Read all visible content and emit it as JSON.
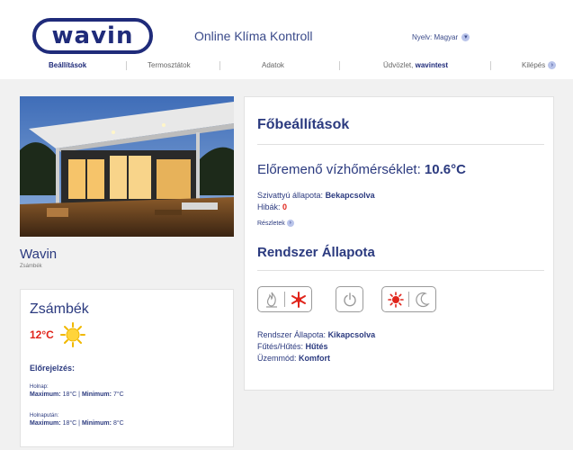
{
  "header": {
    "logo_text": "wavin",
    "app_title": "Online Klíma Kontroll",
    "language_label": "Nyelv:",
    "language_value": "Magyar"
  },
  "nav": {
    "items": [
      "Beállítások",
      "Termosztátok",
      "Adatok"
    ],
    "welcome_label": "Üdvözlet,",
    "welcome_user": "wavintest",
    "logout": "Kilépés"
  },
  "location": {
    "name": "Wavin",
    "sub": "Zsámbék"
  },
  "weather": {
    "city": "Zsámbék",
    "temp": "12°C",
    "forecast_title": "Előrejelzés:",
    "days": [
      {
        "label": "Holnap:",
        "max_label": "Maximum:",
        "max": "18°C",
        "min_label": "Minimum:",
        "min": "7°C"
      },
      {
        "label": "Holnapután:",
        "max_label": "Maximum:",
        "max": "18°C",
        "min_label": "Minimum:",
        "min": "8°C"
      }
    ]
  },
  "main": {
    "title": "Főbeállítások",
    "flow_label": "Előremenő vízhőmérséklet:",
    "flow_value": "10.6°C",
    "pump_label": "Szivattyú állapota:",
    "pump_value": "Bekapcsolva",
    "errors_label": "Hibák:",
    "errors_value": "0",
    "details_link": "Részletek",
    "system_title": "Rendszer Állapota",
    "system_state_label": "Rendszer Állapota:",
    "system_state_value": "Kikapcsolva",
    "heat_cool_label": "Fűtés/Hűtés:",
    "heat_cool_value": "Hűtés",
    "mode_label": "Üzemmód:",
    "mode_value": "Komfort"
  },
  "colors": {
    "brand": "#1f2b7a",
    "accent_red": "#e0241b",
    "text_blue": "#2b3a7f"
  },
  "icons": [
    "flame-icon",
    "snowflake-icon",
    "power-icon",
    "sun-icon",
    "moon-icon",
    "weather-sun-icon",
    "chevron-right-icon",
    "chevron-down-icon"
  ]
}
